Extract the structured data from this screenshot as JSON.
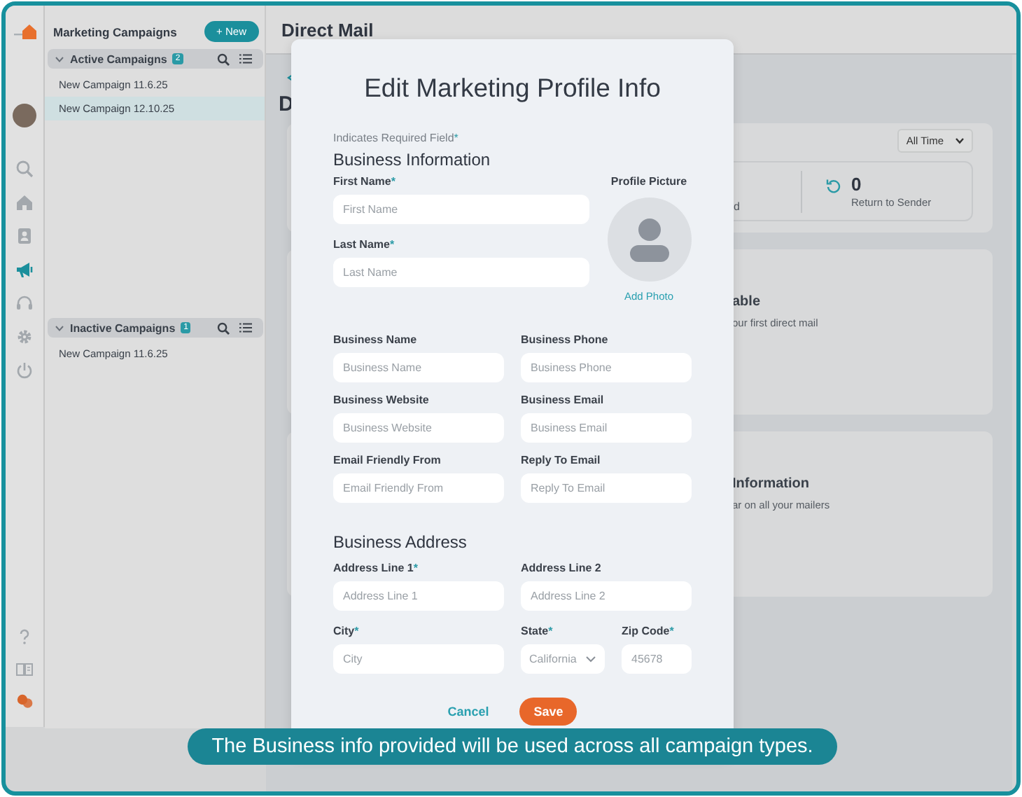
{
  "rail": {
    "items": [
      {
        "kind": "search",
        "selected": false
      },
      {
        "kind": "home",
        "selected": false
      },
      {
        "kind": "contact",
        "selected": false
      },
      {
        "kind": "megaphone",
        "selected": true
      },
      {
        "kind": "headset",
        "selected": false
      },
      {
        "kind": "gear",
        "selected": false
      },
      {
        "kind": "power",
        "selected": false
      }
    ],
    "bottom_items": [
      {
        "kind": "help",
        "selected": false
      },
      {
        "kind": "book",
        "selected": false
      },
      {
        "kind": "chat",
        "selected": false
      }
    ]
  },
  "sidebar": {
    "title": "Marketing Campaigns",
    "new_button": "+ New",
    "sections": [
      {
        "title": "Active Campaigns",
        "count": "2",
        "expanded": true,
        "items": [
          {
            "label": "New Campaign 11.6.25",
            "selected": false
          },
          {
            "label": "New Campaign 12.10.25",
            "selected": true
          }
        ]
      },
      {
        "title": "Inactive Campaigns",
        "count": "1",
        "expanded": true,
        "items": [
          {
            "label": "New Campaign 11.6.25",
            "selected": false
          }
        ]
      }
    ]
  },
  "main": {
    "header_title": "Direct Mail",
    "page_title": "D",
    "filter": "All Time",
    "stat_fragment": "d",
    "stats": [
      {
        "value": "0",
        "label": "Return to Sender"
      }
    ],
    "cards": [
      {
        "title": "able",
        "text": "our first direct mail"
      },
      {
        "title": "Information",
        "text": "ar on all your mailers"
      }
    ]
  },
  "modal": {
    "title": "Edit Marketing Profile Info",
    "required_note": "Indicates Required Field",
    "required_mark": "*",
    "info_heading": "Business Information",
    "name_fields": [
      {
        "label": "First Name",
        "required": true,
        "placeholder": "First Name"
      },
      {
        "label": "Last Name",
        "required": true,
        "placeholder": "Last Name"
      }
    ],
    "profile": {
      "label": "Profile Picture",
      "link": "Add Photo"
    },
    "info_fields": [
      {
        "label": "Business Name",
        "required": false,
        "placeholder": "Business Name"
      },
      {
        "label": "Business Phone",
        "required": false,
        "placeholder": "Business Phone"
      },
      {
        "label": "Business Website",
        "required": false,
        "placeholder": "Business Website"
      },
      {
        "label": "Business Email",
        "required": false,
        "placeholder": "Business Email"
      },
      {
        "label": "Email Friendly From",
        "required": false,
        "placeholder": "Email Friendly From"
      },
      {
        "label": "Reply To Email",
        "required": false,
        "placeholder": "Reply To Email"
      }
    ],
    "address_heading": "Business Address",
    "address_rows": [
      [
        {
          "kind": "text",
          "label": "Address Line 1",
          "required": true,
          "placeholder": "Address Line 1"
        },
        {
          "kind": "text",
          "label": "Address Line 2",
          "required": false,
          "placeholder": "Address Line 2"
        }
      ],
      [
        {
          "kind": "text",
          "label": "City",
          "required": true,
          "placeholder": "City"
        },
        {
          "kind": "select",
          "label": "State",
          "required": true,
          "value": "California"
        },
        {
          "kind": "text",
          "label": "Zip Code",
          "required": true,
          "placeholder": "45678"
        }
      ]
    ],
    "cancel": "Cancel",
    "save": "Save"
  },
  "caption": "The Business info provided will be used across all campaign types."
}
